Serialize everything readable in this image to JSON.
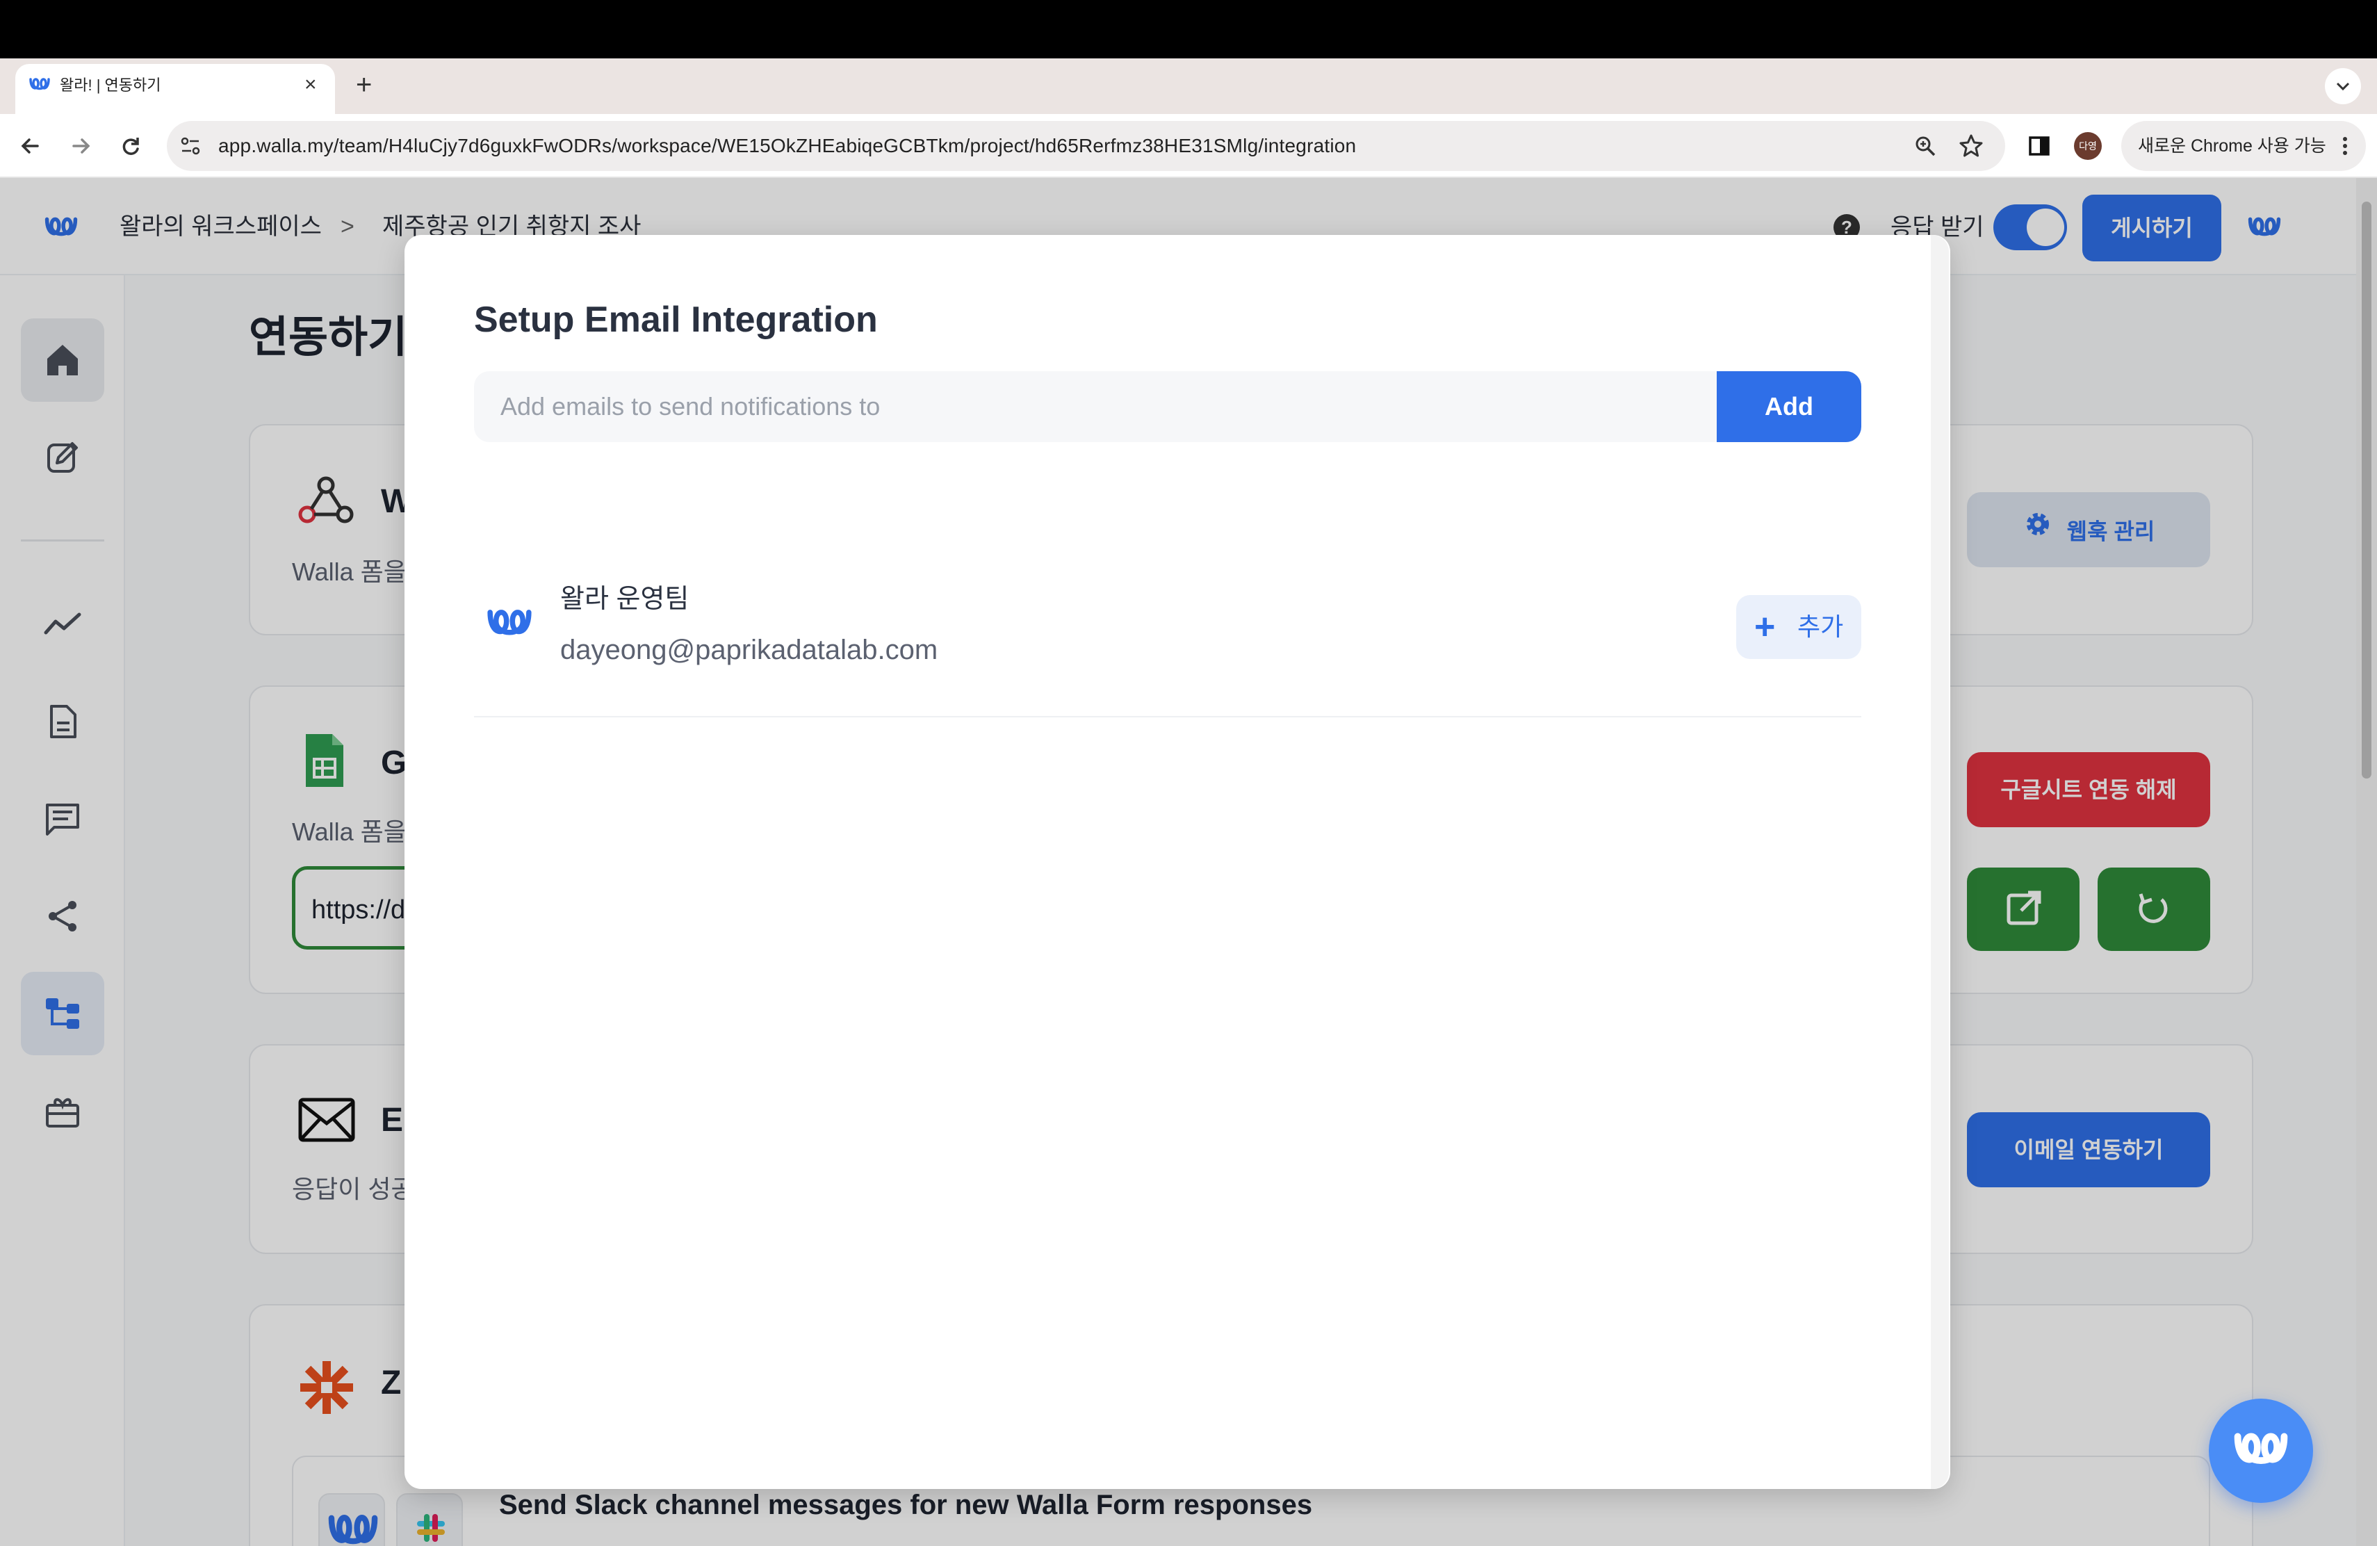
{
  "browser": {
    "tab_title": "왈라! | 연동하기",
    "tab_close": "×",
    "tab_new": "+",
    "url": "app.walla.my/team/H4luCjy7d6guxkFwODRs/workspace/WE15OkZHEabiqeGCBTkm/project/hd65Rerfmz38HE31SMlg/integration",
    "profile_initial": "다영",
    "profile_label": "새로운 Chrome 사용 가능"
  },
  "header": {
    "workspace": "왈라의 워크스페이스",
    "separator": ">",
    "project": "제주항공 인기 취항지 조사",
    "help": "?",
    "receive_responses": "응답 받기",
    "receive_on": true,
    "publish": "게시하기"
  },
  "sidebar": {
    "items": [
      {
        "icon": "home-icon",
        "active": false
      },
      {
        "icon": "edit-icon",
        "active": false
      },
      {
        "icon": "analytics-icon",
        "active": false
      },
      {
        "icon": "document-icon",
        "active": false
      },
      {
        "icon": "comments-icon",
        "active": false
      },
      {
        "icon": "share-icon",
        "active": false
      },
      {
        "icon": "integration-icon",
        "active": true
      },
      {
        "icon": "gift-icon",
        "active": false
      }
    ]
  },
  "page": {
    "title": "연동하기",
    "webhook": {
      "title_initial": "W",
      "desc": "Walla 폼을",
      "button": "웹훅 관리"
    },
    "gsheet": {
      "title_initial": "G",
      "desc": "Walla 폼을",
      "url_value": "https://d",
      "unlink_button": "구글시트 연동 해제"
    },
    "email": {
      "title_initial": "E",
      "desc": "응답이 성공",
      "button": "이메일 연동하기"
    },
    "zapier": {
      "title_initial": "Z",
      "zap_title": "Send Slack channel messages for new Walla Form responses"
    }
  },
  "modal": {
    "title": "Setup Email Integration",
    "input_placeholder": "Add emails to send notifications to",
    "add_button": "Add",
    "members": [
      {
        "name": "왈라 운영팀",
        "email": "dayeong@paprikadatalab.com",
        "add_label": "추가",
        "add_plus": "+"
      }
    ]
  },
  "colors": {
    "brand": "#2f6fe8",
    "danger": "#e03340",
    "success": "#2f8a3a"
  }
}
